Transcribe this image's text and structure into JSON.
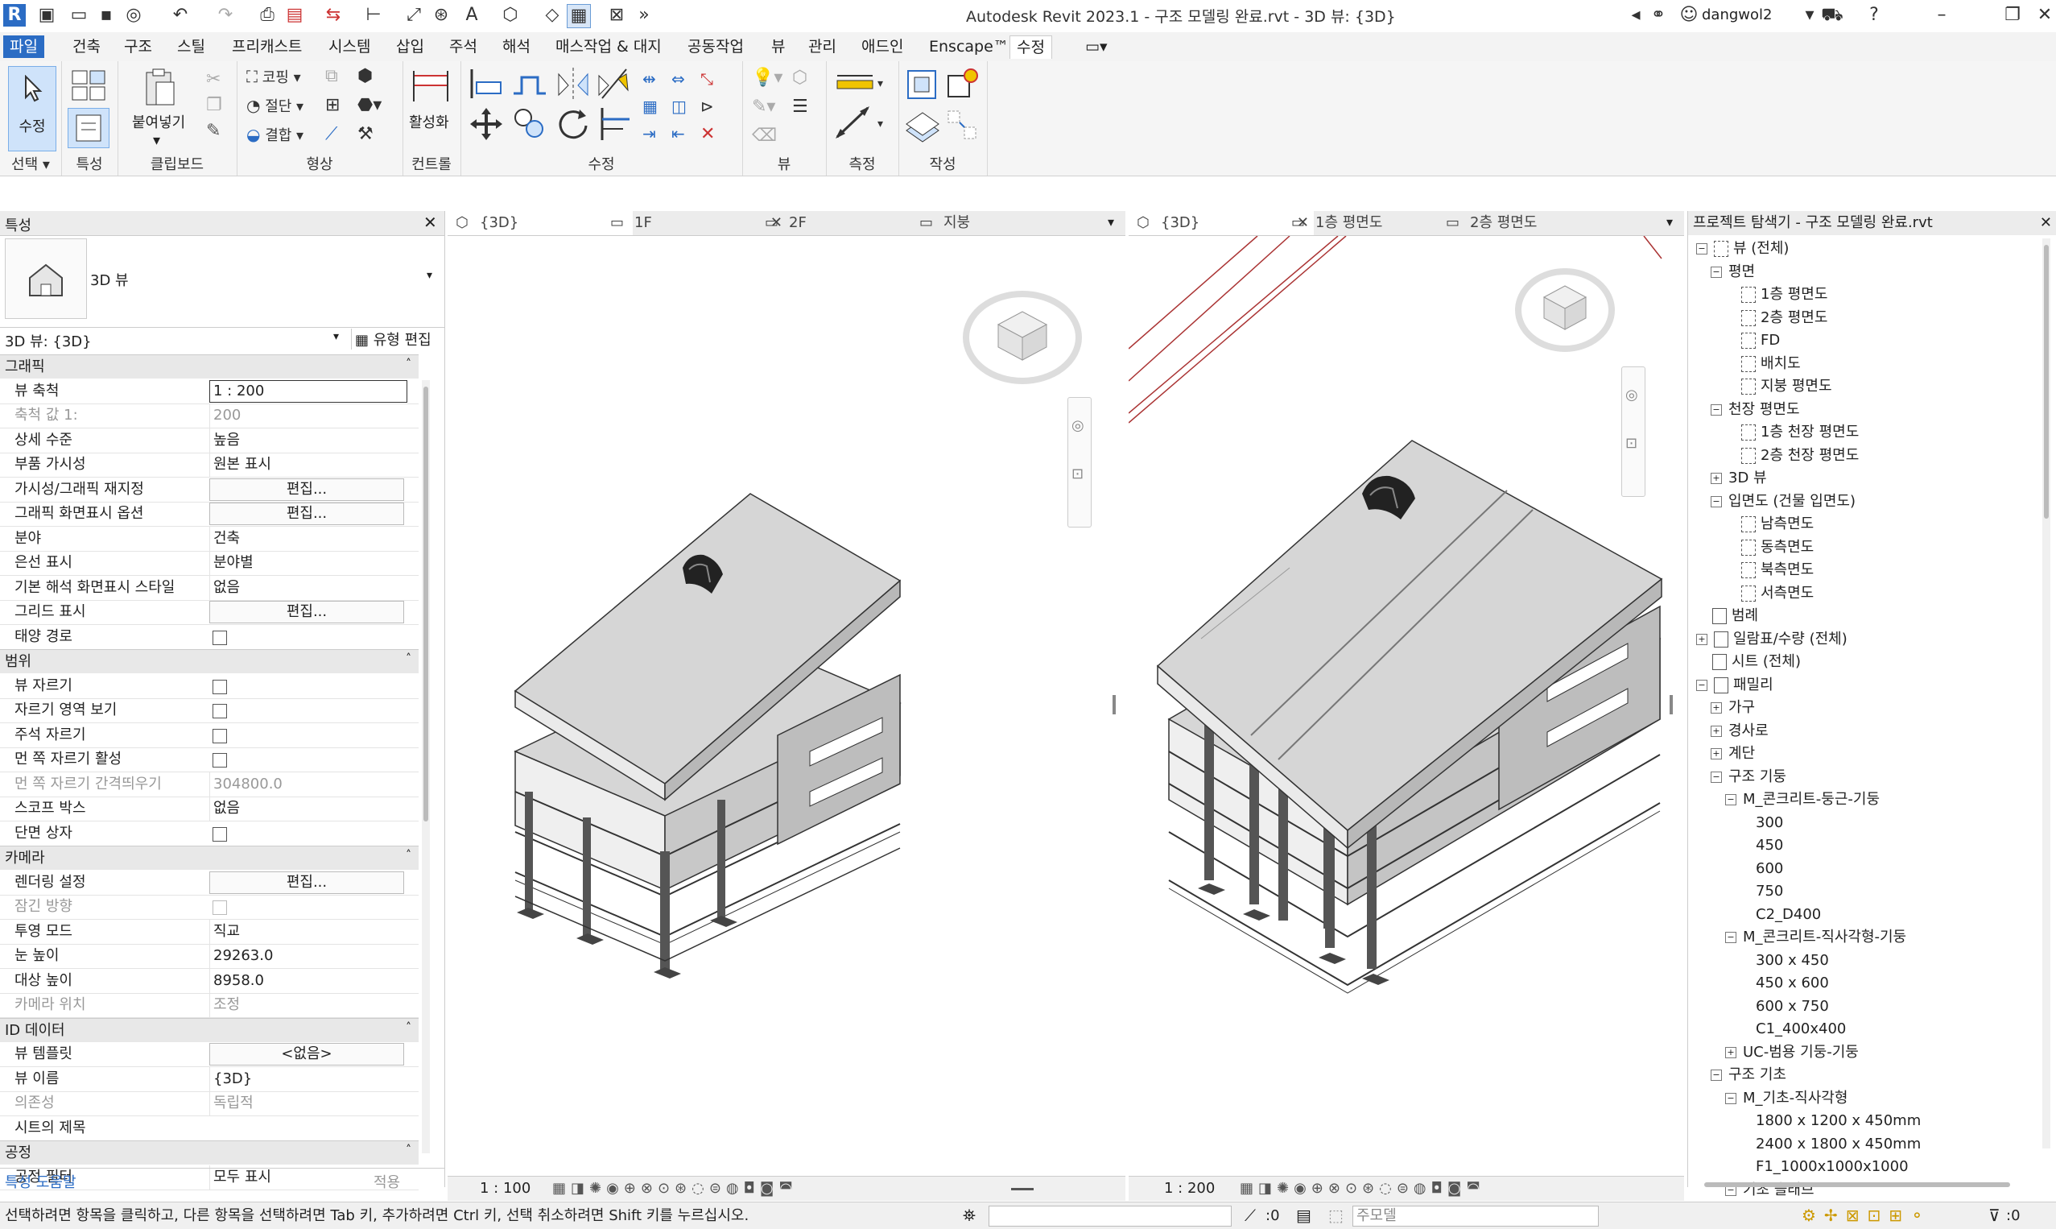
{
  "titlebar": {
    "title": "Autodesk Revit 2023.1 - 구조 모델링 완료.rvt - 3D 뷰: {3D}",
    "user": "dangwol2"
  },
  "menu": {
    "tabs": [
      "파일",
      "건축",
      "구조",
      "스틸",
      "프리캐스트",
      "시스템",
      "삽입",
      "주석",
      "해석",
      "매스작업 & 대지",
      "공동작업",
      "뷰",
      "관리",
      "애드인",
      "Enscape™",
      "수정"
    ]
  },
  "ribbon": {
    "select_label": "선택",
    "modify_btn": "수정",
    "properties_label": "특성",
    "clipboard_label": "클립보드",
    "paste_btn": "붙여넣기",
    "geometry_label": "형상",
    "cope": "코핑",
    "cut": "절단",
    "join": "결합",
    "controls_label": "컨트롤",
    "activate_btn": "활성화",
    "modify_label": "수정",
    "view_label": "뷰",
    "measure_label": "측정",
    "create_label": "작성"
  },
  "properties": {
    "header": "특성",
    "type_name": "3D 뷰",
    "selector": "3D 뷰: {3D}",
    "edit_type": "유형 편집",
    "sections": [
      {
        "title": "그래픽",
        "rows": [
          {
            "k": "뷰 축척",
            "v": "1 : 200",
            "kind": "input"
          },
          {
            "k": "축척 값    1:",
            "v": "200",
            "kind": "dim"
          },
          {
            "k": "상세 수준",
            "v": "높음"
          },
          {
            "k": "부품 가시성",
            "v": "원본 표시"
          },
          {
            "k": "가시성/그래픽 재지정",
            "v": "편집...",
            "kind": "btn"
          },
          {
            "k": "그래픽 화면표시 옵션",
            "v": "편집...",
            "kind": "btn"
          },
          {
            "k": "분야",
            "v": "건축"
          },
          {
            "k": "은선 표시",
            "v": "분야별"
          },
          {
            "k": "기본 해석 화면표시 스타일",
            "v": "없음"
          },
          {
            "k": "그리드 표시",
            "v": "편집...",
            "kind": "btn"
          },
          {
            "k": "태양 경로",
            "v": "",
            "kind": "chk"
          }
        ]
      },
      {
        "title": "범위",
        "rows": [
          {
            "k": "뷰 자르기",
            "v": "",
            "kind": "chk"
          },
          {
            "k": "자르기 영역 보기",
            "v": "",
            "kind": "chk"
          },
          {
            "k": "주석 자르기",
            "v": "",
            "kind": "chk"
          },
          {
            "k": "먼 쪽 자르기 활성",
            "v": "",
            "kind": "chk"
          },
          {
            "k": "먼 쪽 자르기 간격띄우기",
            "v": "304800.0",
            "kind": "dim"
          },
          {
            "k": "스코프 박스",
            "v": "없음"
          },
          {
            "k": "단면 상자",
            "v": "",
            "kind": "chk"
          }
        ]
      },
      {
        "title": "카메라",
        "rows": [
          {
            "k": "렌더링 설정",
            "v": "편집...",
            "kind": "btn"
          },
          {
            "k": "잠긴 방향",
            "v": "",
            "kind": "chkdim"
          },
          {
            "k": "투영 모드",
            "v": "직교"
          },
          {
            "k": "눈 높이",
            "v": "29263.0"
          },
          {
            "k": "대상 높이",
            "v": "8958.0"
          },
          {
            "k": "카메라 위치",
            "v": "조정",
            "kind": "dim"
          }
        ]
      },
      {
        "title": "ID 데이터",
        "rows": [
          {
            "k": "뷰 템플릿",
            "v": "<없음>",
            "kind": "btn"
          },
          {
            "k": "뷰 이름",
            "v": "{3D}"
          },
          {
            "k": "의존성",
            "v": "독립적",
            "kind": "dim"
          },
          {
            "k": "시트의 제목",
            "v": ""
          }
        ]
      },
      {
        "title": "공정",
        "rows": [
          {
            "k": "공정 필터",
            "v": "모두 표시"
          }
        ]
      }
    ],
    "help_link": "특성 도움말",
    "apply_btn": "적용"
  },
  "view_left": {
    "tabs": [
      "{3D}",
      "1F",
      "2F",
      "지붕"
    ],
    "scale": "1 : 100"
  },
  "view_right": {
    "tabs": [
      "{3D}",
      "1층 평면도",
      "2층 평면도"
    ],
    "scale": "1 : 200"
  },
  "browser": {
    "header": "프로젝트 탐색기 - 구조 모델링 완료.rvt",
    "nodes": [
      {
        "label": "뷰 (전체)",
        "lvl": 0,
        "tog": "-",
        "icon": "view"
      },
      {
        "label": "평면",
        "lvl": 1,
        "tog": "-"
      },
      {
        "label": "1층 평면도",
        "lvl": 2,
        "icon": "view"
      },
      {
        "label": "2층 평면도",
        "lvl": 2,
        "icon": "view"
      },
      {
        "label": "FD",
        "lvl": 2,
        "icon": "view"
      },
      {
        "label": "배치도",
        "lvl": 2,
        "icon": "view"
      },
      {
        "label": "지붕 평면도",
        "lvl": 2,
        "icon": "view"
      },
      {
        "label": "천장 평면도",
        "lvl": 1,
        "tog": "-"
      },
      {
        "label": "1층 천장 평면도",
        "lvl": 2,
        "icon": "view"
      },
      {
        "label": "2층 천장 평면도",
        "lvl": 2,
        "icon": "view"
      },
      {
        "label": "3D 뷰",
        "lvl": 1,
        "tog": "+"
      },
      {
        "label": "입면도 (건물 입면도)",
        "lvl": 1,
        "tog": "-"
      },
      {
        "label": "남측면도",
        "lvl": 2,
        "icon": "view"
      },
      {
        "label": "동측면도",
        "lvl": 2,
        "icon": "view"
      },
      {
        "label": "북측면도",
        "lvl": 2,
        "icon": "view"
      },
      {
        "label": "서측면도",
        "lvl": 2,
        "icon": "view"
      },
      {
        "label": "범례",
        "lvl": 0,
        "icon": "legend"
      },
      {
        "label": "일람표/수량 (전체)",
        "lvl": 0,
        "tog": "+",
        "icon": "schedule"
      },
      {
        "label": "시트 (전체)",
        "lvl": 0,
        "icon": "sheet"
      },
      {
        "label": "패밀리",
        "lvl": 0,
        "tog": "-",
        "icon": "family"
      },
      {
        "label": "가구",
        "lvl": 1,
        "tog": "+"
      },
      {
        "label": "경사로",
        "lvl": 1,
        "tog": "+"
      },
      {
        "label": "계단",
        "lvl": 1,
        "tog": "+"
      },
      {
        "label": "구조 기둥",
        "lvl": 1,
        "tog": "-"
      },
      {
        "label": "M_콘크리트-둥근-기둥",
        "lvl": 2,
        "tog": "-"
      },
      {
        "label": "300",
        "lvl": 3
      },
      {
        "label": "450",
        "lvl": 3
      },
      {
        "label": "600",
        "lvl": 3
      },
      {
        "label": "750",
        "lvl": 3
      },
      {
        "label": "C2_D400",
        "lvl": 3
      },
      {
        "label": "M_콘크리트-직사각형-기둥",
        "lvl": 2,
        "tog": "-"
      },
      {
        "label": "300 x 450",
        "lvl": 3
      },
      {
        "label": "450 x 600",
        "lvl": 3
      },
      {
        "label": "600 x 750",
        "lvl": 3
      },
      {
        "label": "C1_400x400",
        "lvl": 3
      },
      {
        "label": "UC-범용 기둥-기둥",
        "lvl": 2,
        "tog": "+"
      },
      {
        "label": "구조 기초",
        "lvl": 1,
        "tog": "-"
      },
      {
        "label": "M_기초-직사각형",
        "lvl": 2,
        "tog": "-"
      },
      {
        "label": "1800 x 1200 x 450mm",
        "lvl": 3
      },
      {
        "label": "2400 x 1800 x 450mm",
        "lvl": 3
      },
      {
        "label": "F1_1000x1000x1000",
        "lvl": 3
      },
      {
        "label": "기초 슬래브",
        "lvl": 2,
        "tog": "-"
      }
    ]
  },
  "statusbar": {
    "message": "선택하려면 항목을 클릭하고, 다른 항목을 선택하려면 Tab 키, 추가하려면 Ctrl 키, 선택 취소하려면 Shift 키를 누르십시오.",
    "zero": ":0",
    "model": "주모델",
    "filter_count": ":0"
  },
  "colors": {
    "accent": "#2b6cc4",
    "slab": "#d6d6d6",
    "highlight": "#a8c8f0"
  }
}
